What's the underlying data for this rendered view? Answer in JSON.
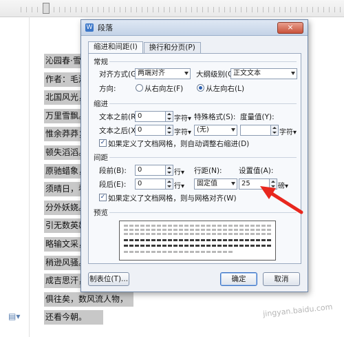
{
  "document": {
    "lines": [
      "沁园春·雪",
      "作者：毛泽",
      "北国风光，",
      "万里雪飘。",
      "惟余莽莽；",
      "顿失滔滔。",
      "原驰蜡象，",
      "须晴日，看",
      "分外妖娆。",
      "引无数英雄",
      "略输文采，",
      "稍逊风骚。",
      "成吉思汗，",
      "俱往矣，数风流人物，",
      "还看今朝。"
    ]
  },
  "watermark": "jingyan.baidu.com",
  "dialog": {
    "title": "段落",
    "close_label": "×",
    "tabs": [
      "缩进和间距(I)",
      "换行和分页(P)"
    ],
    "general": {
      "section_title": "常规",
      "align_label": "对齐方式(G):",
      "align_value": "两端对齐",
      "outline_label": "大纲级别(O):",
      "outline_value": "正文文本",
      "direction_label": "方向:",
      "dir_rtl": "从右向左(F)",
      "dir_ltr": "从左向右(L)",
      "dir_selected": "ltr"
    },
    "indent": {
      "section_title": "缩进",
      "before_label": "文本之前(R):",
      "before_value": "0",
      "before_unit": "字符▾",
      "special_label": "特殊格式(S):",
      "special_value": "(无)",
      "measure_label": "度量值(Y):",
      "measure_value": "",
      "measure_unit": "字符▾",
      "after_label": "文本之后(X):",
      "after_value": "0",
      "after_unit": "字符▾",
      "grid_checkbox": "如果定义了文档网格，则自动调整右缩进(D)",
      "grid_checked": true
    },
    "spacing": {
      "section_title": "间距",
      "before_label": "段前(B):",
      "before_value": "0",
      "before_unit": "行▾",
      "line_label": "行距(N):",
      "line_value": "固定值",
      "setting_label": "设置值(A):",
      "setting_value": "25",
      "setting_unit": "磅▾",
      "after_label": "段后(E):",
      "after_value": "0",
      "after_unit": "行▾",
      "grid_checkbox": "如果定义了文档网格，则与网格对齐(W)",
      "grid_checked": true
    },
    "preview": {
      "section_title": "预览"
    },
    "buttons": {
      "tabs": "制表位(T)...",
      "ok": "确定",
      "cancel": "取消"
    }
  },
  "colors": {
    "annotation_arrow": "#e8271e",
    "title_bar": "#c4d3e7",
    "doc_highlight": "#c8c8c8"
  },
  "icons": [
    "app-logo-icon",
    "close-icon",
    "dropdown-arrow-icon",
    "spin-up-icon",
    "spin-down-icon",
    "checkbox-check-icon",
    "page-icon"
  ]
}
